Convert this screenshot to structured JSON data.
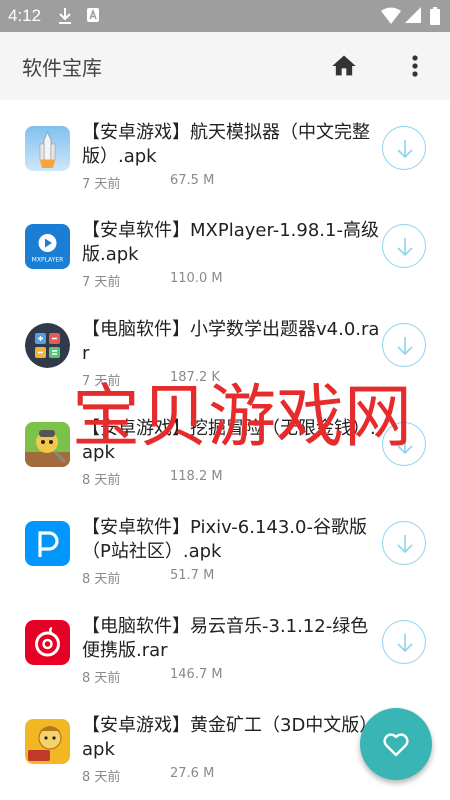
{
  "status_bar": {
    "time": "4:12"
  },
  "app_bar": {
    "title": "软件宝库",
    "home_icon": "home-icon",
    "more_icon": "more-vert-icon"
  },
  "items": [
    {
      "title": "【安卓游戏】航天模拟器（中文完整版）.apk",
      "age": "7 天前",
      "size": "67.5 M",
      "icon": "rocket-icon"
    },
    {
      "title": "【安卓软件】MXPlayer-1.98.1-高级版.apk",
      "age": "7 天前",
      "size": "110.0 M",
      "icon": "mxplayer-icon"
    },
    {
      "title": "【电脑软件】小学数学出题器v4.0.rar",
      "age": "7 天前",
      "size": "187.2 K",
      "icon": "math-icon"
    },
    {
      "title": "【安卓游戏】挖掘冒险（无限金钱）.apk",
      "age": "8 天前",
      "size": "118.2 M",
      "icon": "digger-icon"
    },
    {
      "title": "【安卓软件】Pixiv-6.143.0-谷歌版（P站社区）.apk",
      "age": "8 天前",
      "size": "51.7 M",
      "icon": "pixiv-icon"
    },
    {
      "title": "【电脑软件】易云音乐-3.1.12-绿色便携版.rar",
      "age": "8 天前",
      "size": "146.7 M",
      "icon": "netease-music-icon"
    },
    {
      "title": "【安卓游戏】黄金矿工（3D中文版）.apk",
      "age": "8 天前",
      "size": "27.6 M",
      "icon": "gold-miner-icon"
    }
  ],
  "watermark": "宝贝游戏网",
  "fab_icon": "heart-icon",
  "colors": {
    "status_bar": "#9e9e9e",
    "app_bar": "#f5f5f5",
    "accent": "#3ab5b5",
    "download_ring": "#8fd3ef",
    "watermark": "#e52b2b"
  }
}
